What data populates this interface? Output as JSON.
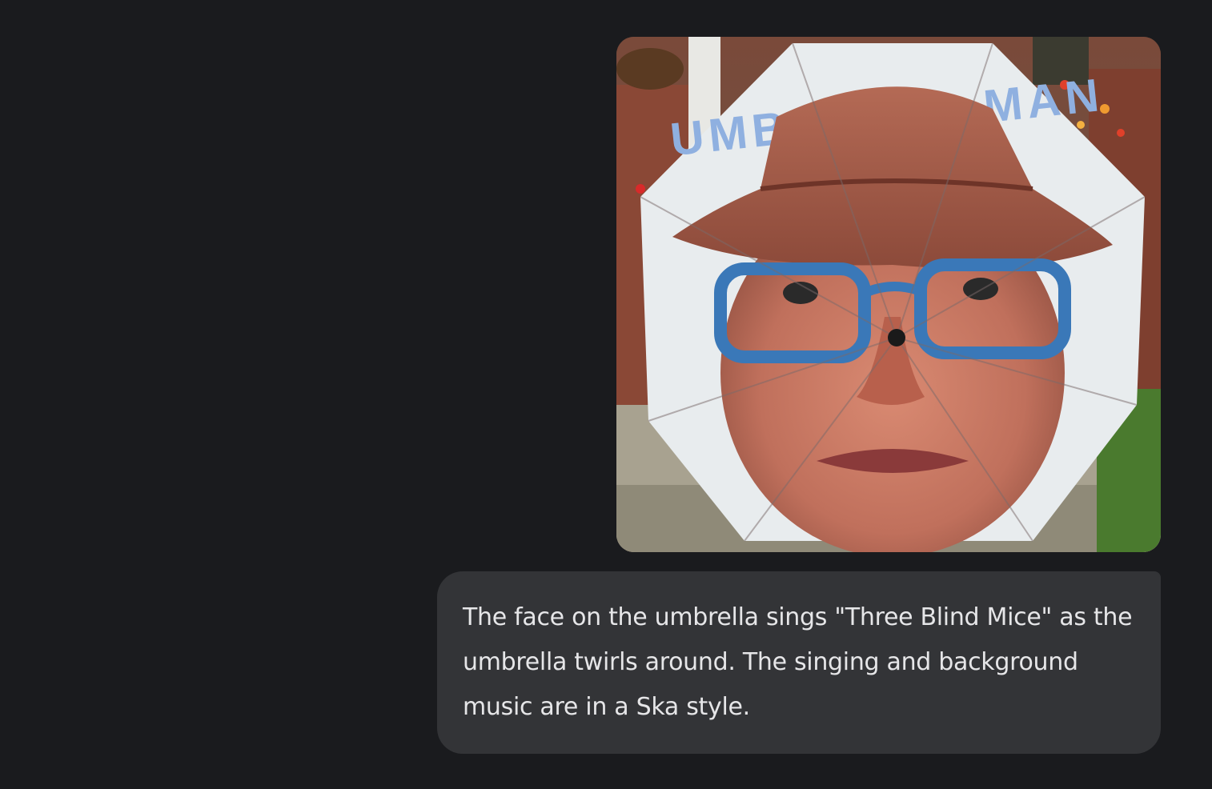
{
  "conversation": {
    "user_message": {
      "text": "The face on the umbrella sings \"Three Blind Mice\" as the umbrella twirls around. The singing and background music are in a Ska style."
    },
    "attachment": {
      "umbrella_print_text": "UMBRELLA MAN"
    }
  },
  "colors": {
    "background": "#1a1b1e",
    "bubble": "#333437",
    "text": "#e6e6e8"
  }
}
